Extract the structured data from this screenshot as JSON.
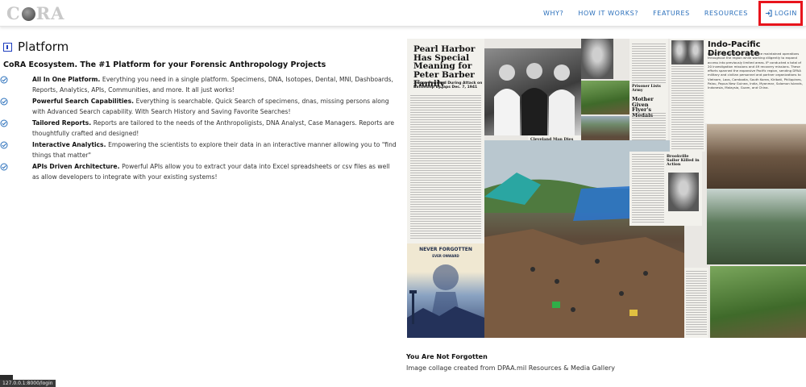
{
  "brand": {
    "prefix": "C",
    "suffix": "RA",
    "skull_icon": "skull-icon"
  },
  "nav": {
    "items": [
      {
        "label": "WHY?"
      },
      {
        "label": "HOW IT WORKS?"
      },
      {
        "label": "FEATURES"
      },
      {
        "label": "RESOURCES"
      }
    ],
    "login_label": "LOGIN",
    "login_icon": "login-arrow-icon",
    "link_color": "#2a6fbb",
    "highlight_color": "#e8141c"
  },
  "main": {
    "title": "Platform",
    "title_icon": "info-square-icon",
    "subtitle": "CoRA Ecosystem. The #1 Platform for your Forensic Anthropology Projects",
    "features": [
      {
        "title": "All In One Platform.",
        "text": "Everything you need in a single platform. Specimens, DNA, Isotopes, Dental, MNI, Dashboards, Reports, Analytics, APIs, Communities, and more. It all just works!"
      },
      {
        "title": "Powerful Search Capabilities.",
        "text": "Everything is searchable. Quick Search of specimens, dnas, missing persons along with Advanced Search capability. With Search History and Saving Favorite Searches!"
      },
      {
        "title": "Tailored Reports.",
        "text": "Reports are tailored to the needs of the Anthropoligists, DNA Analyst, Case Managers. Reports are thoughtfully crafted and designed!"
      },
      {
        "title": "Interactive Analytics.",
        "text": "Empowering the scientists to explore their data in an interactive manner allowing you to \"find things that matter\""
      },
      {
        "title": "APIs Driven Architecture.",
        "text": "Powerful APIs allow you to extract your data into Excel spreadsheets or csv files as well as allow developers to integrate with your existing systems!"
      }
    ],
    "check_icon": "check-circle-icon",
    "check_color": "#2a6fbb"
  },
  "collage": {
    "headline": "Pearl Harbor Has Special Meaning for Peter Barber Family",
    "headline_sub": "3 Sons Perished During Attack on Battleship by Japs Dec. 7, 1941",
    "indo_title": "Indo-Pacific Directorate",
    "indo_text": "DPAA's Indo-Pacific (IP) Directorate maintained operations throughout the region while working diligently to expand access into previously limited areas. IP conducted a total of 20 investigation missions and 49 recovery missions. These efforts spanned the expansive Pacific region, sending DPAA military and civilian personnel and partner organizations to Vietnam, Laos, Cambodia, South Korea, Kiribati, Philippines, Palau, Papua New Guinea, India, Myanmar, Solomon Islands, Indonesia, Malaysia, Guam, and China.",
    "poster_title": "NEVER FORGOTTEN",
    "poster_sub": "EVER ONWARD",
    "clip_1": "Mother Given Flyer's Medals",
    "clip_2": "Cleveland Man Dies in Jap Prison Camp",
    "clip_3": "Brookville Sailor Killed in Action",
    "clip_4": "Prisoner Lists Army"
  },
  "caption": {
    "title": "You Are Not Forgotten",
    "text": "Image collage created from DPAA.mil Resources & Media Gallery"
  },
  "status": {
    "url": "127.0.0.1:8000/login"
  }
}
